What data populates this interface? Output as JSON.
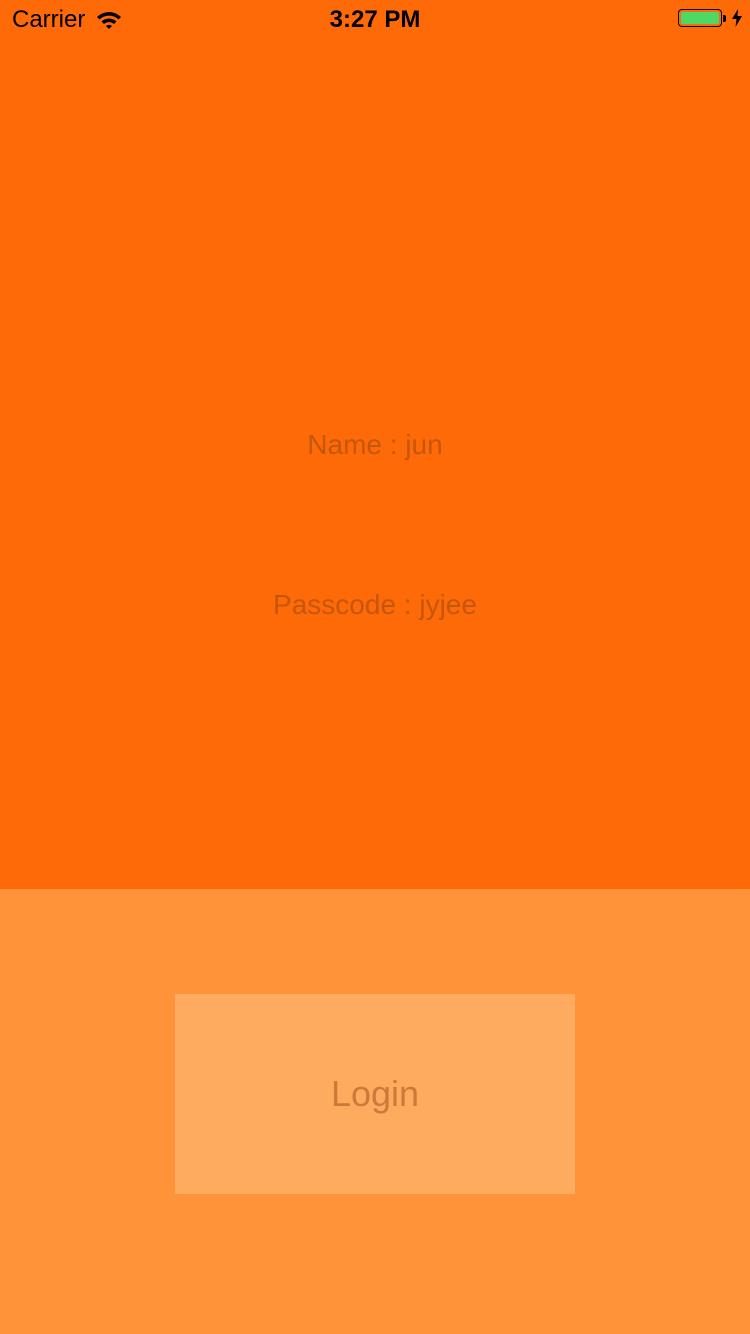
{
  "status_bar": {
    "carrier": "Carrier",
    "time": "3:27 PM",
    "wifi_icon": "wifi-icon",
    "battery_icon": "battery-icon",
    "charging_icon": "charging-bolt-icon",
    "battery_level": 1.0
  },
  "form": {
    "name_label": "Name : jun",
    "passcode_label": "Passcode : jyjee"
  },
  "actions": {
    "login_label": "Login"
  },
  "colors": {
    "top_background": "#FE6A08",
    "bottom_background": "#FE9339",
    "button_background": "#FEAA5F",
    "label_text": "#C4570B",
    "button_text": "#CB7A3A",
    "battery_fill": "#4CD964"
  }
}
